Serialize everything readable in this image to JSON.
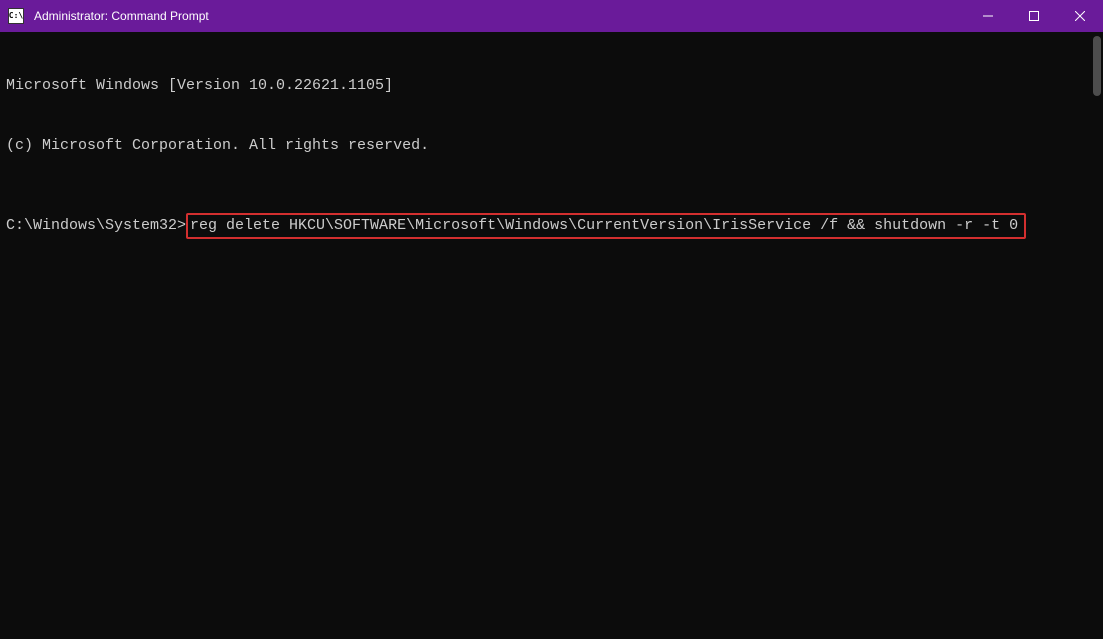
{
  "titlebar": {
    "title": "Administrator: Command Prompt",
    "icon_label": "C:\\"
  },
  "terminal": {
    "line1": "Microsoft Windows [Version 10.0.22621.1105]",
    "line2": "(c) Microsoft Corporation. All rights reserved.",
    "prompt": "C:\\Windows\\System32>",
    "command": "reg delete HKCU\\SOFTWARE\\Microsoft\\Windows\\CurrentVersion\\IrisService /f && shutdown -r -t 0"
  }
}
